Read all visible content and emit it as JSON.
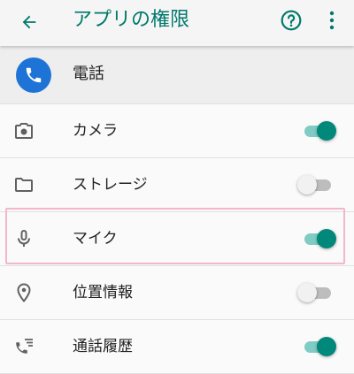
{
  "appbar": {
    "back_icon": "arrow-back-icon",
    "title": "アプリの権限",
    "help_icon": "help-circle-icon",
    "more_icon": "more-vert-icon"
  },
  "app": {
    "icon": "phone-icon",
    "name": "電話"
  },
  "permissions": [
    {
      "icon": "camera-icon",
      "label": "カメラ",
      "enabled": true
    },
    {
      "icon": "folder-icon",
      "label": "ストレージ",
      "enabled": false
    },
    {
      "icon": "microphone-icon",
      "label": "マイク",
      "enabled": true,
      "highlighted": true
    },
    {
      "icon": "location-icon",
      "label": "位置情報",
      "enabled": false
    },
    {
      "icon": "call-log-icon",
      "label": "通話履歴",
      "enabled": true
    }
  ],
  "colors": {
    "accent": "#00796b",
    "toggle_on_thumb": "#00897b",
    "toggle_on_track": "#80cbc4",
    "app_icon_bg": "#1e74d6",
    "highlight_border": "#f3b6cd"
  }
}
